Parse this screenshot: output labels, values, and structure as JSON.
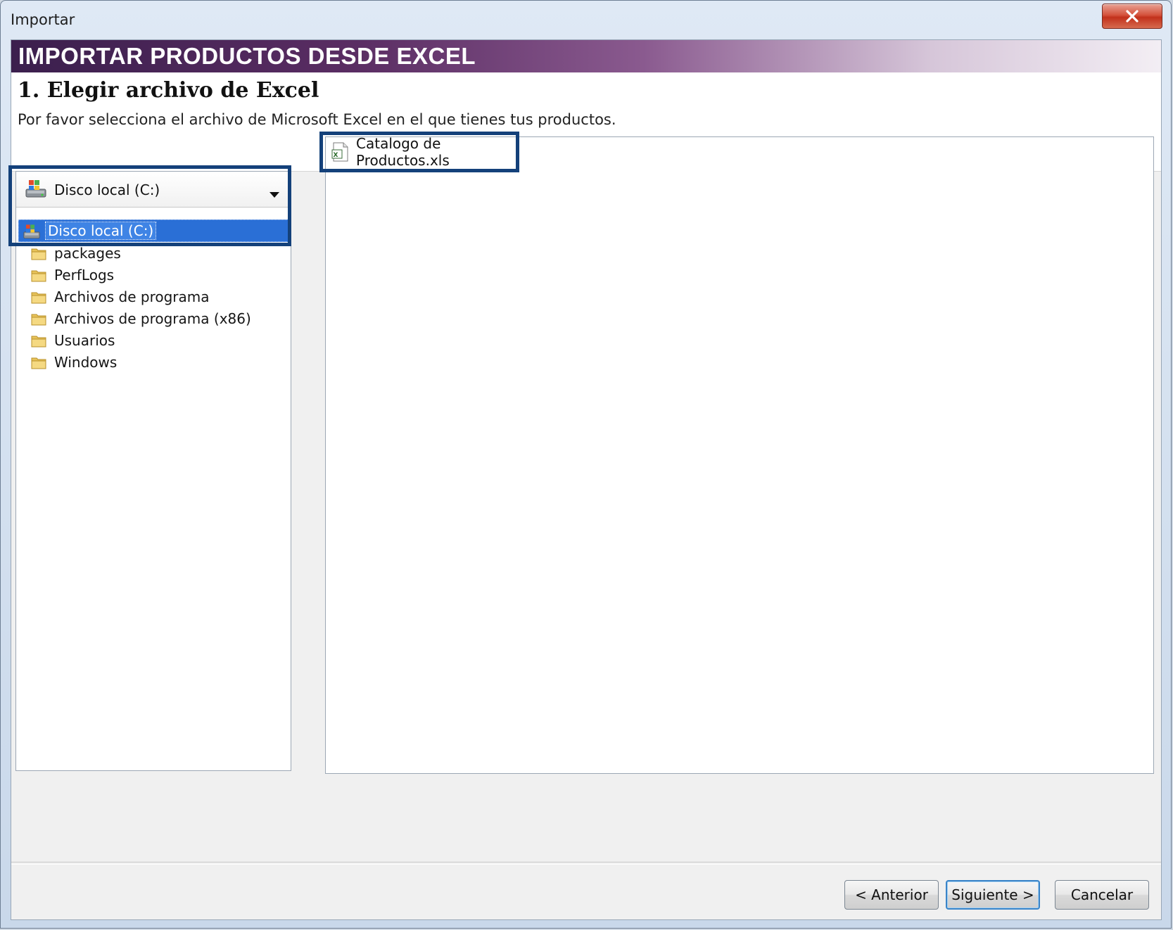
{
  "window": {
    "title": "Importar"
  },
  "banner": {
    "title": "IMPORTAR PRODUCTOS DESDE EXCEL"
  },
  "step": {
    "title": "1. Elegir archivo de Excel",
    "description": "Por favor selecciona el archivo de Microsoft Excel en el que tienes tus productos."
  },
  "drive_selector": {
    "selected": "Disco local (C:)",
    "icon": "drive-icon"
  },
  "folder_tree": {
    "current": "Disco local (C:)",
    "items": [
      {
        "label": "packages",
        "icon": "folder-icon"
      },
      {
        "label": "PerfLogs",
        "icon": "folder-icon"
      },
      {
        "label": "Archivos de programa",
        "icon": "folder-icon"
      },
      {
        "label": "Archivos de programa (x86)",
        "icon": "folder-icon"
      },
      {
        "label": "Usuarios",
        "icon": "folder-icon"
      },
      {
        "label": "Windows",
        "icon": "folder-icon"
      }
    ]
  },
  "files": [
    {
      "label": "Catalogo de Productos.xls",
      "icon": "excel-file-icon"
    }
  ],
  "buttons": {
    "back": "< Anterior",
    "next": "Siguiente >",
    "cancel": "Cancelar"
  },
  "colors": {
    "highlight": "#14417a",
    "selection": "#2a6fd6"
  }
}
